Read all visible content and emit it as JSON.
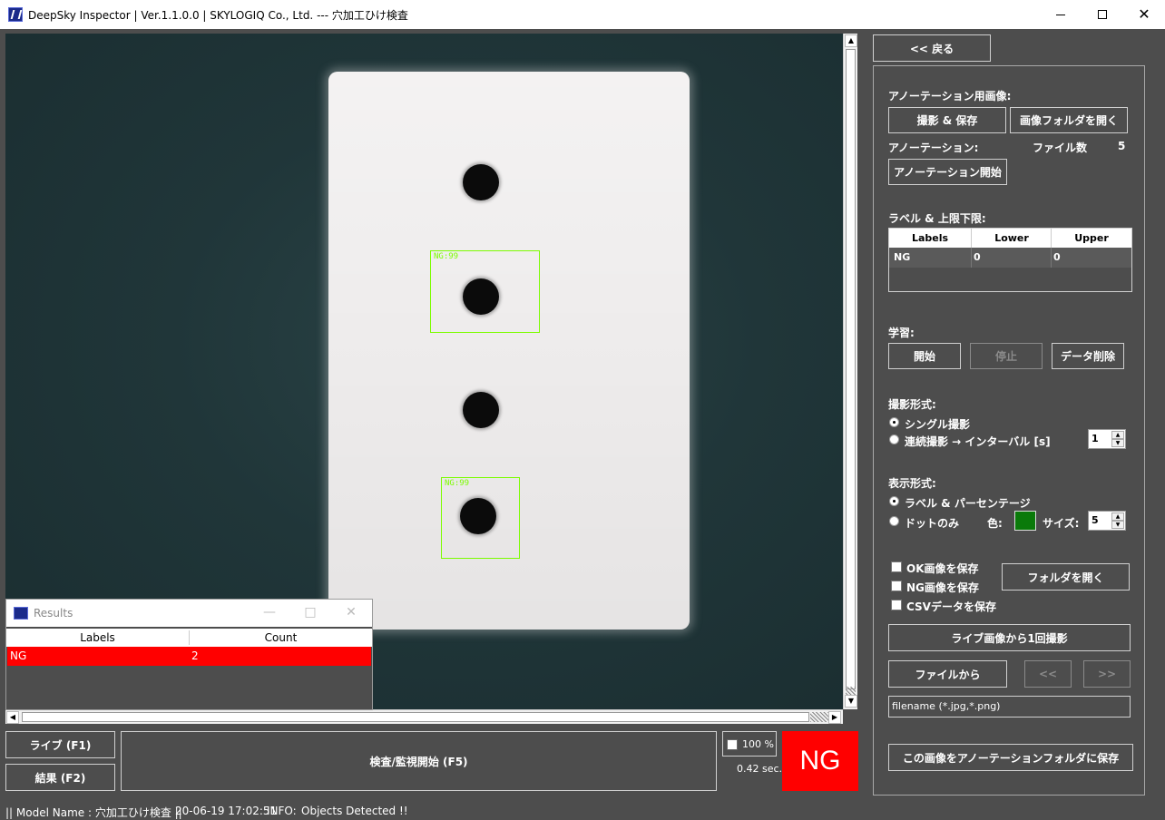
{
  "window": {
    "title": "DeepSky Inspector | Ver.1.1.0.0 | SKYLOGIQ Co., Ltd. --- 穴加工ひけ検査",
    "minimize": "—",
    "maximize": "□",
    "close": "✕"
  },
  "detections": [
    {
      "label": "NG:99"
    },
    {
      "label": "NG:99"
    }
  ],
  "results_window": {
    "title": "Results",
    "columns": [
      "Labels",
      "Count"
    ],
    "rows": [
      {
        "label": "NG",
        "count": "2"
      }
    ],
    "highlight_color": "#ff0000"
  },
  "bottom": {
    "live_button": "ライブ (F1)",
    "result_button": "結果 (F2)",
    "inspect_button": "検査/監視開始 (F5)",
    "zoom_label": "100 %",
    "elapsed": "0.42 sec.",
    "verdict": "NG",
    "verdict_color": "#ff0000"
  },
  "status": {
    "model": "|| Model Name : 穴加工ひけ検査 ||",
    "timestamp": "20-06-19 17:02:51",
    "info_label": "INFO:",
    "info_text": "Objects Detected !!"
  },
  "right_panel": {
    "back_button": "<< 戻る",
    "annotation_images_label": "アノーテーション用画像:",
    "capture_save_button": "撮影 & 保存",
    "open_image_folder_button": "画像フォルダを開く",
    "annotation_label": "アノーテーション:",
    "file_count_label": "ファイル数",
    "file_count_value": "5",
    "start_annotation_button": "アノーテーション開始",
    "label_limits_label": "ラベル & 上限下限:",
    "limits_table": {
      "columns": [
        "Labels",
        "Lower",
        "Upper"
      ],
      "rows": [
        {
          "label": "NG",
          "lower": "0",
          "upper": "0"
        }
      ]
    },
    "training_label": "学習:",
    "train_start_button": "開始",
    "train_stop_button": "停止",
    "data_delete_button": "データ削除",
    "capture_mode_label": "撮影形式:",
    "capture_single": "シングル撮影",
    "capture_continuous": "連続撮影 → インターバル [s]",
    "interval_value": "1",
    "display_mode_label": "表示形式:",
    "display_label_percent": "ラベル & パーセンテージ",
    "display_dot_only": "ドットのみ",
    "color_label": "色:",
    "dot_color": "#0a7a0a",
    "size_label": "サイズ:",
    "size_value": "5",
    "save_ok_label": "OK画像を保存",
    "save_ng_label": "NG画像を保存",
    "save_csv_label": "CSVデータを保存",
    "open_folder_button": "フォルダを開く",
    "capture_once_button": "ライブ画像から1回撮影",
    "from_file_button": "ファイルから",
    "prev_button": "<<",
    "next_button": ">>",
    "filename_placeholder": "filename (*.jpg,*.png)",
    "save_to_annotation_button": "この画像をアノーテーションフォルダに保存"
  }
}
